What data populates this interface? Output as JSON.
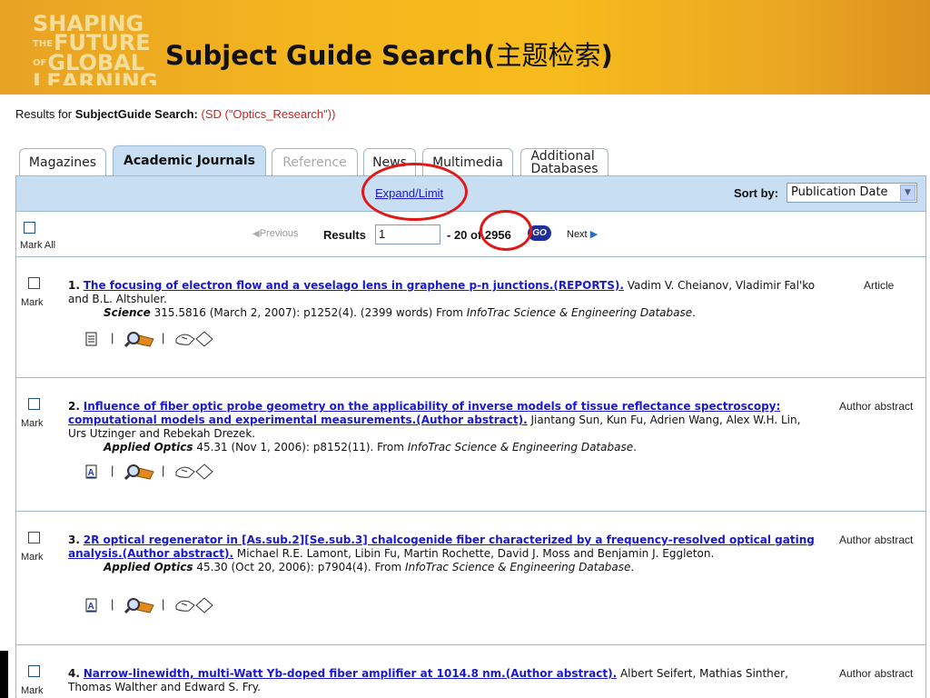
{
  "banner": {
    "logo_lines": [
      "SHAPING",
      "FUTURE",
      "GLOBAL",
      "LEARNING"
    ],
    "logo_small": [
      "THE",
      "OF"
    ],
    "title": "Subject Guide Search(",
    "title_cjk": "主题检索",
    "title_close": ")"
  },
  "results_for": {
    "prefix": "Results for",
    "label": "SubjectGuide Search:",
    "query": "(SD (\"Optics_Research\"))"
  },
  "tabs": [
    {
      "label": "Magazines",
      "state": "normal"
    },
    {
      "label": "Academic Journals",
      "state": "active"
    },
    {
      "label": "Reference",
      "state": "disabled"
    },
    {
      "label": "News",
      "state": "normal"
    },
    {
      "label": "Multimedia",
      "state": "normal"
    },
    {
      "label_line1": "Additional",
      "label_line2": "Databases",
      "state": "normal"
    }
  ],
  "toolbar": {
    "expand_label": "Expand/Limit",
    "sort_label": "Sort by:",
    "sort_value": "Publication Date",
    "sort_arrow": "▼"
  },
  "pager": {
    "mark_all": "Mark All",
    "previous": "Previous",
    "results_label": "Results",
    "page_value": "1",
    "range_text": "- 20  of 2956",
    "go_label": "GO",
    "next": "Next"
  },
  "results": [
    {
      "num": "1.",
      "title": "The focusing of electron flow and a veselago lens in graphene p-n junctions.(REPORTS).",
      "authors": " Vadim V. Cheianov, Vladimir Fal'ko and B.L. Altshuler.",
      "journal": "Science",
      "citation": " 315.5816 (March 2, 2007): p1252(4). (2399 words) From ",
      "database": "InfoTrac Science & Engineering Database",
      "end": ".",
      "type": "Article",
      "mark": "Mark",
      "doc_icon": "full-text-document-icon"
    },
    {
      "num": "2.",
      "title": "Influence of fiber optic probe geometry on the applicability of inverse models of tissue reflectance spectroscopy: computational models and experimental measurements.(Author abstract).",
      "authors": " Jiantang Sun, Kun Fu, Adrien Wang, Alex W.H. Lin, Urs Utzinger and Rebekah Drezek.",
      "journal": "Applied Optics",
      "citation": " 45.31 (Nov 1, 2006): p8152(11). From ",
      "database": "InfoTrac Science & Engineering Database",
      "end": ".",
      "type": "Author abstract",
      "mark": "Mark",
      "doc_icon": "abstract-document-icon"
    },
    {
      "num": "3.",
      "title": "2R optical regenerator in [As.sub.2][Se.sub.3] chalcogenide fiber characterized by a frequency-resolved optical gating analysis.(Author abstract).",
      "authors": " Michael R.E. Lamont, Libin Fu, Martin Rochette, David J. Moss and Benjamin J. Eggleton.",
      "journal": "Applied Optics",
      "citation": " 45.30 (Oct 20, 2006): p7904(4). From ",
      "database": "InfoTrac Science & Engineering Database",
      "end": ".",
      "type": "Author abstract",
      "mark": "Mark",
      "doc_icon": "abstract-document-icon"
    },
    {
      "num": "4.",
      "title": "Narrow-linewidth, multi-Watt Yb-doped fiber amplifier at 1014.8 nm.(Author abstract).",
      "authors": " Albert Seifert, Mathias Sinther, Thomas Walther and Edward S. Fry.",
      "journal": "",
      "citation": "",
      "database": "",
      "end": "",
      "type": "Author abstract",
      "mark": "Mark",
      "doc_icon": ""
    }
  ],
  "icon_separator": "|",
  "icons": {
    "search": "magnifier-icon",
    "handshake": "link-hand-icon"
  },
  "colors": {
    "banner": "#f4b61e",
    "tab_active": "#c7def3",
    "link": "#1a1acc",
    "query": "#cc2222",
    "annotation": "#e01818"
  }
}
